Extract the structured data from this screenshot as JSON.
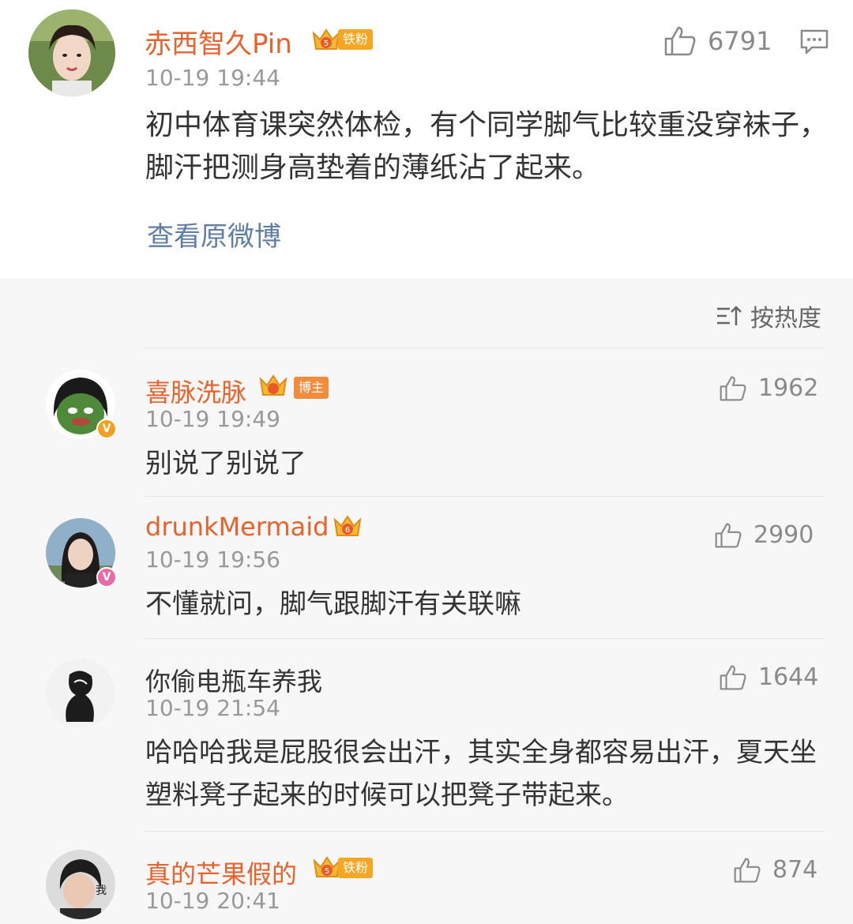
{
  "post": {
    "username": "赤西智久Pin",
    "level": "5",
    "fan_badge": "铁粉",
    "time": "10-19 19:44",
    "likes": "6791",
    "text": "初中体育课突然体检，有个同学脚气比较重没穿袜子，脚汗把测身高垫着的薄纸沾了起来。",
    "view_original": "查看原微博"
  },
  "sort": {
    "label": "按热度"
  },
  "comments": [
    {
      "username": "喜脉洗脉",
      "badge": "博主",
      "time": "10-19 19:49",
      "likes": "1962",
      "text": "别说了别说了"
    },
    {
      "username": "drunkMermaid",
      "level": "6",
      "time": "10-19 19:56",
      "likes": "2990",
      "text": "不懂就问，脚气跟脚汗有关联嘛"
    },
    {
      "username": "你偷电瓶车养我",
      "time": "10-19 21:54",
      "likes": "1644",
      "text": "哈哈哈我是屁股很会出汗，其实全身都容易出汗，夏天坐塑料凳子起来的时候可以把凳子带起来。"
    },
    {
      "username": "真的芒果假的",
      "level": "5",
      "fan_badge": "铁粉",
      "time": "10-19 20:41",
      "likes": "874",
      "avatar_text": "我"
    }
  ],
  "colors": {
    "username": "#e8632c",
    "link": "#5f7ea6",
    "time": "#999999",
    "background": "#f7f7f7"
  }
}
